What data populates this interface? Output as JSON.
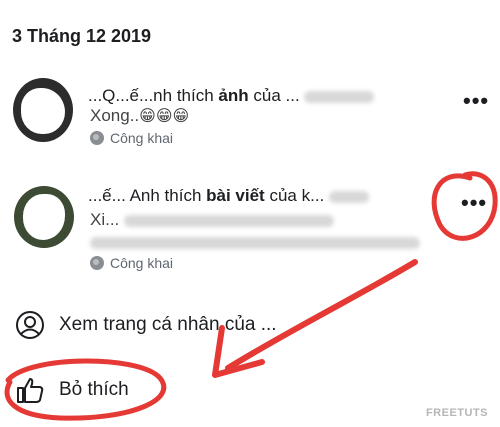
{
  "date_header": "3 Tháng 12 2019",
  "notifications": [
    {
      "title_prefix": "...Q...ế...nh thích ",
      "title_bold": "ảnh",
      "title_suffix": " của ...",
      "body": "Xong..",
      "emoji": "😁😁😁",
      "privacy": "Công khai",
      "more_label": "•••"
    },
    {
      "title_prefix": "...ế... Anh thích ",
      "title_bold": "bài viết",
      "title_suffix": " của k...",
      "body_line1": "Xi...",
      "body_line2": "...",
      "privacy": "Công khai",
      "more_label": "•••"
    }
  ],
  "menu": {
    "view_profile": "Xem trang cá nhân của ...",
    "like": "Bỏ thích"
  },
  "watermark": "FREETUTS",
  "colors": {
    "annotation": "#e53935",
    "privacy_text": "#606770"
  }
}
